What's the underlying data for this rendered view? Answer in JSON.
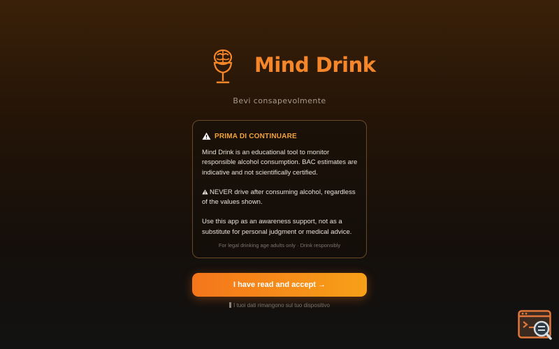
{
  "brand": {
    "title": "Mind Drink",
    "logo_icon": "brain-wine-glass-icon",
    "accent_color": "#f5862a"
  },
  "tagline": "Bevi consapevolmente",
  "disclaimer": {
    "heading_icon": "warning-icon",
    "heading": "PRIMA DI CONTINUARE",
    "paragraph1": "Mind Drink is an educational tool to monitor responsible alcohol consumption. BAC estimates are indicative and not scientifically certified.",
    "paragraph2_icon": "warning-icon",
    "paragraph2": "NEVER drive after consuming alcohol, regardless of the values shown.",
    "paragraph3": "Use this app as an awareness support, not as a substitute for personal judgment or medical advice.",
    "footnote": "For legal drinking age adults only · Drink responsibly"
  },
  "accept_button": {
    "label": "I have read and accept →",
    "gradient_start": "#f5761a",
    "gradient_end": "#f7a018"
  },
  "privacy_note": {
    "icon": "lock-icon",
    "text": "I tuoi dati rimangono sul tuo dispositivo"
  },
  "corner_widget": {
    "icon": "devtools-inspector-icon"
  }
}
